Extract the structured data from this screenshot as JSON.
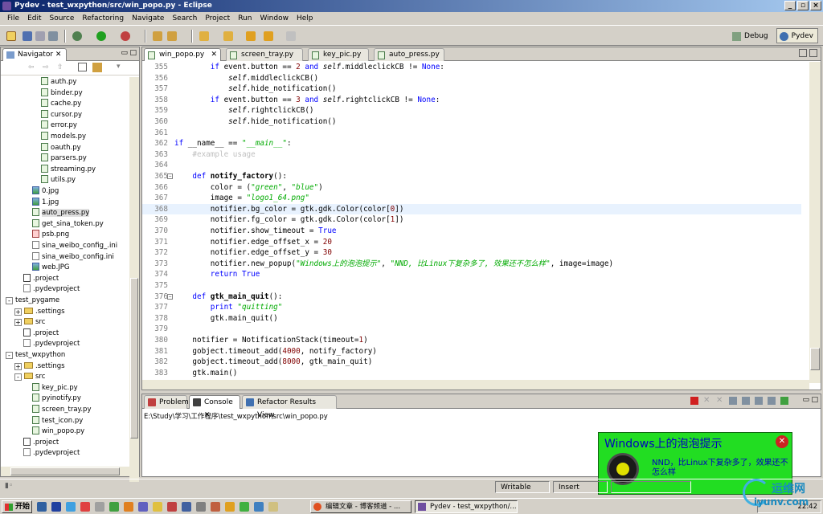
{
  "window": {
    "title": "Pydev - test_wxpython/src/win_popo.py - Eclipse"
  },
  "menu": [
    "File",
    "Edit",
    "Source",
    "Refactoring",
    "Navigate",
    "Search",
    "Project",
    "Run",
    "Window",
    "Help"
  ],
  "perspectives": {
    "debug": "Debug",
    "pydev": "Pydev"
  },
  "navigator": {
    "title": "Navigator",
    "tree": [
      {
        "label": "auth.py",
        "icon": "py",
        "depth": 4
      },
      {
        "label": "binder.py",
        "icon": "py",
        "depth": 4
      },
      {
        "label": "cache.py",
        "icon": "py",
        "depth": 4
      },
      {
        "label": "cursor.py",
        "icon": "py",
        "depth": 4
      },
      {
        "label": "error.py",
        "icon": "py",
        "depth": 4
      },
      {
        "label": "models.py",
        "icon": "py",
        "depth": 4
      },
      {
        "label": "oauth.py",
        "icon": "py",
        "depth": 4
      },
      {
        "label": "parsers.py",
        "icon": "py",
        "depth": 4
      },
      {
        "label": "streaming.py",
        "icon": "py",
        "depth": 4
      },
      {
        "label": "utils.py",
        "icon": "py",
        "depth": 4
      },
      {
        "label": "0.jpg",
        "icon": "img",
        "depth": 3
      },
      {
        "label": "1.jpg",
        "icon": "img",
        "depth": 3
      },
      {
        "label": "auto_press.py",
        "icon": "py",
        "depth": 3,
        "selected": true
      },
      {
        "label": "get_sina_token.py",
        "icon": "py",
        "depth": 3
      },
      {
        "label": "psb.png",
        "icon": "png",
        "depth": 3
      },
      {
        "label": "sina_weibo_config_.ini",
        "icon": "ini",
        "depth": 3
      },
      {
        "label": "sina_weibo_config.ini",
        "icon": "ini",
        "depth": 3
      },
      {
        "label": "web.JPG",
        "icon": "img",
        "depth": 3
      },
      {
        "label": ".project",
        "icon": "x",
        "depth": 2
      },
      {
        "label": ".pydevproject",
        "icon": "ini",
        "depth": 2
      },
      {
        "label": "test_pygame",
        "icon": "none",
        "depth": 0,
        "expander": "-"
      },
      {
        "label": ".settings",
        "icon": "folder",
        "depth": 1,
        "expander": "+"
      },
      {
        "label": "src",
        "icon": "folder",
        "depth": 1,
        "expander": "+"
      },
      {
        "label": ".project",
        "icon": "x",
        "depth": 2
      },
      {
        "label": ".pydevproject",
        "icon": "ini",
        "depth": 2
      },
      {
        "label": "test_wxpython",
        "icon": "none",
        "depth": 0,
        "expander": "-"
      },
      {
        "label": ".settings",
        "icon": "folder",
        "depth": 1,
        "expander": "+"
      },
      {
        "label": "src",
        "icon": "folder",
        "depth": 1,
        "expander": "-"
      },
      {
        "label": "key_pic.py",
        "icon": "py",
        "depth": 3
      },
      {
        "label": "pyinotify.py",
        "icon": "py",
        "depth": 3
      },
      {
        "label": "screen_tray.py",
        "icon": "py",
        "depth": 3
      },
      {
        "label": "test_icon.py",
        "icon": "py",
        "depth": 3
      },
      {
        "label": "win_popo.py",
        "icon": "py",
        "depth": 3
      },
      {
        "label": ".project",
        "icon": "x",
        "depth": 2
      },
      {
        "label": ".pydevproject",
        "icon": "ini",
        "depth": 2
      }
    ]
  },
  "editor": {
    "tabs": [
      "win_popo.py",
      "screen_tray.py",
      "key_pic.py",
      "auto_press.py"
    ],
    "active_tab": 0,
    "highlight_line": 368,
    "lines": [
      {
        "n": "355",
        "h": "        <span class=kw>if</span> event.button == <span class=num>2</span> <span class=kw>and</span> <span class=sf>self</span>.middleclickCB != <span class=kw>None</span>:"
      },
      {
        "n": "356",
        "h": "            <span class=sf>self</span>.middleclickCB()"
      },
      {
        "n": "357",
        "h": "            <span class=sf>self</span>.hide_notification()"
      },
      {
        "n": "358",
        "h": "        <span class=kw>if</span> event.button == <span class=num>3</span> <span class=kw>and</span> <span class=sf>self</span>.rightclickCB != <span class=kw>None</span>:"
      },
      {
        "n": "359",
        "h": "            <span class=sf>self</span>.rightclickCB()"
      },
      {
        "n": "360",
        "h": "            <span class=sf>self</span>.hide_notification()"
      },
      {
        "n": "361",
        "h": ""
      },
      {
        "n": "362",
        "h": "<span class=kw>if</span> __name__ == <span class=st>\"__main__\"</span>:"
      },
      {
        "n": "363",
        "h": "    <span class=cm>#example usage</span>"
      },
      {
        "n": "364",
        "h": ""
      },
      {
        "n": "365",
        "h": "    <span class=kw>def</span> <span class=bd>notify_factory</span>():",
        "fold": true
      },
      {
        "n": "366",
        "h": "        color = (<span class=st>\"green\"</span>, <span class=st>\"blue\"</span>)"
      },
      {
        "n": "367",
        "h": "        image = <span class=st>\"logo1_64.png\"</span>"
      },
      {
        "n": "368",
        "h": "        notifier.bg_color = gtk.gdk.Color(color[<span class=num>0</span>])"
      },
      {
        "n": "369",
        "h": "        notifier.fg_color = gtk.gdk.Color(color[<span class=num>1</span>])"
      },
      {
        "n": "370",
        "h": "        notifier.show_timeout = <span class=kw>True</span>"
      },
      {
        "n": "371",
        "h": "        notifier.edge_offset_x = <span class=num>20</span>"
      },
      {
        "n": "372",
        "h": "        notifier.edge_offset_y = <span class=num>30</span>"
      },
      {
        "n": "373",
        "h": "        notifier.new_popup(<span class=st>\"Windows上的泡泡提示\"</span>, <span class=st>\"NND, 比Linux下复杂多了, 效果还不怎么样\"</span>, image=image)"
      },
      {
        "n": "374",
        "h": "        <span class=kw>return</span> <span class=kw>True</span>"
      },
      {
        "n": "375",
        "h": ""
      },
      {
        "n": "376",
        "h": "    <span class=kw>def</span> <span class=bd>gtk_main_quit</span>():",
        "fold": true
      },
      {
        "n": "377",
        "h": "        <span class=kw>print</span> <span class=st>\"quitting\"</span>"
      },
      {
        "n": "378",
        "h": "        gtk.main_quit()"
      },
      {
        "n": "379",
        "h": ""
      },
      {
        "n": "380",
        "h": "    notifier = NotificationStack(timeout=<span class=num>1</span>)"
      },
      {
        "n": "381",
        "h": "    gobject.timeout_add(<span class=num>4000</span>, notify_factory)"
      },
      {
        "n": "382",
        "h": "    gobject.timeout_add(<span class=num>8000</span>, gtk_main_quit)"
      },
      {
        "n": "383",
        "h": "    gtk.main()"
      }
    ]
  },
  "bottom_panel": {
    "tabs": [
      "Problems",
      "Console",
      "Refactor Results View"
    ],
    "active_tab": 1,
    "console_path": "E:\\Study\\学习\\工作程序\\test_wxpython\\src\\win_popo.py"
  },
  "popup": {
    "title": "Windows上的泡泡提示",
    "message": "NND，比Linux下复杂多了，效果还不怎么样",
    "bg": "#22dd22",
    "text_color": "#0000c0"
  },
  "status": {
    "writable": "Writable",
    "insert": "Insert"
  },
  "taskbar": {
    "start": "开始",
    "tasks": [
      "编辑文章 - 博客频道 - ...",
      "Pydev - test_wxpython/..."
    ],
    "clock": "22:42"
  },
  "watermark": {
    "line1": "运维网",
    "line2": "iyunv.com"
  }
}
